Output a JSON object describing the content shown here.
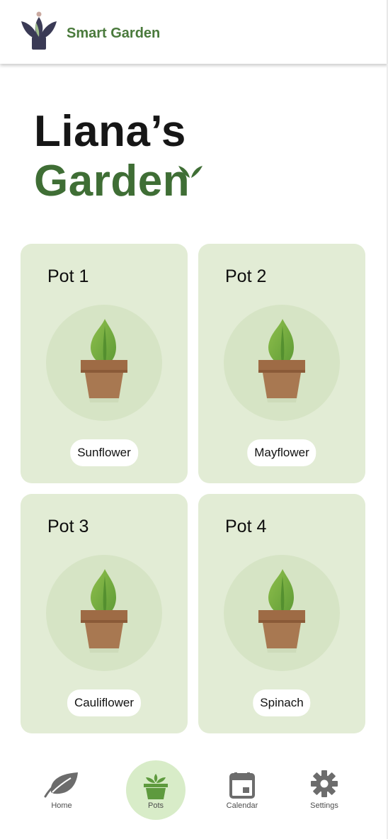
{
  "app": {
    "title": "Smart Garden"
  },
  "greeting": {
    "line1": "Liana’s",
    "line2": "Garden"
  },
  "pots": [
    {
      "title": "Pot 1",
      "plant": "Sunflower"
    },
    {
      "title": "Pot 2",
      "plant": "Mayflower"
    },
    {
      "title": "Pot 3",
      "plant": "Cauliflower"
    },
    {
      "title": "Pot 4",
      "plant": "Spinach"
    }
  ],
  "nav": {
    "items": [
      {
        "label": "Home",
        "icon": "leaf-icon"
      },
      {
        "label": "Pots",
        "icon": "potted-plant-icon"
      },
      {
        "label": "Calendar",
        "icon": "calendar-icon"
      },
      {
        "label": "Settings",
        "icon": "gear-icon"
      }
    ],
    "active": "Pots"
  },
  "colors": {
    "brand_green": "#4a7a3c",
    "card_bg": "#e2ecd5",
    "nav_active_bg": "#d8ecc8"
  }
}
